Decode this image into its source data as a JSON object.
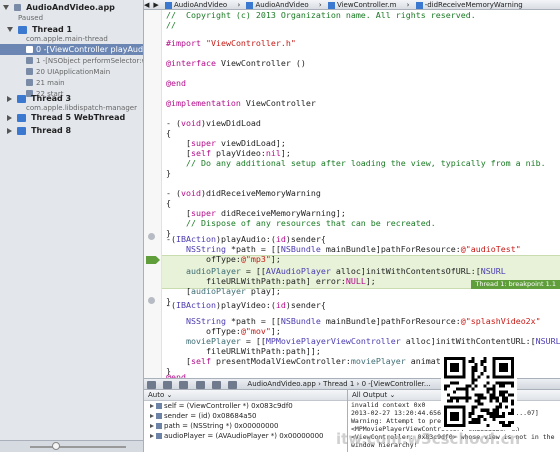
{
  "navigator": {
    "project": "AudioAndVideo.app",
    "status": "Paused",
    "threads": [
      {
        "name": "Thread 1",
        "sub": "com.apple.main-thread",
        "expanded": true,
        "frames": [
          "0 -[ViewController playAudio:]",
          "1 -[NSObject performSelector:wit...",
          "20 UIApplicationMain",
          "21 main",
          "22 start"
        ]
      },
      {
        "name": "Thread 3",
        "sub": "com.apple.libdispatch-manager",
        "expanded": false
      },
      {
        "name": "Thread 5 WebThread",
        "expanded": false
      },
      {
        "name": "Thread 8",
        "expanded": false
      }
    ]
  },
  "jumpbar": {
    "items": [
      "AudioAndVideo",
      "AudioAndVideo",
      "ViewController.m",
      "-didReceiveMemoryWarning"
    ]
  },
  "code": {
    "lines": [
      "//  Copyright (c) 2013 Organization name. All rights reserved.",
      "//",
      "",
      "#import \"ViewController.h\"",
      "",
      "@interface ViewController ()",
      "",
      "@end",
      "",
      "@implementation ViewController",
      "",
      "- (void)viewDidLoad",
      "{",
      "    [super viewDidLoad];",
      "    [self playVideo:nil];",
      "    // Do any additional setup after loading the view, typically from a nib.",
      "}",
      "",
      "- (void)didReceiveMemoryWarning",
      "{",
      "    [super didReceiveMemoryWarning];",
      "    // Dispose of any resources that can be recreated.",
      "}",
      "-(IBAction)playAudio:(id)sender{",
      "    NSString *path = [[NSBundle mainBundle]pathForResource:@\"audioTest\"",
      "        ofType:@\"mp3\"];",
      "",
      "    audioPlayer = [[AVAudioPlayer alloc]initWithContentsOfURL:[NSURL",
      "        fileURLWithPath:path] error:NULL];",
      "    [audioPlayer play];",
      "}",
      "-(IBAction)playVideo:(id)sender{",
      "",
      "    NSString *path = [[NSBundle mainBundle]pathForResource:@\"splashVideo2x\"",
      "        ofType:@\"mov\"];",
      "    moviePlayer = [[MPMoviePlayerViewController alloc]initWithContentURL:[NSURL",
      "        fileURLWithPath:path]];",
      "    [self presentModalViewController:moviePlayer animated:NO];",
      "}",
      "@end"
    ],
    "breakpoint_label": "Thread 1: breakpoint 1.1"
  },
  "debugbar": {
    "crumbs": [
      "AudioAndVideo.app",
      "Thread 1",
      "0 -[ViewController..."
    ]
  },
  "variables": {
    "scope": "Auto",
    "items": [
      "self = (ViewController *) 0x083c9df0",
      "sender = (id) 0x08684a50",
      "path = (NSString *) 0x00000000",
      "audioPlayer = (AVAudioPlayer *) 0x00000000"
    ]
  },
  "console": {
    "scope": "All Output",
    "lines": [
      "invalid context 0x0",
      "2013-02-27 13:20:44.656 AudioAndVideo[...:...07]",
      "Warning: Attempt to present",
      "<MPMoviePlayerViewController: 0x86886b0> on",
      "<ViewController: 0x83c9df0> whose view is not in the",
      "window hierarchy!"
    ]
  },
  "watermark": "itw.com.w3cschool.cn"
}
